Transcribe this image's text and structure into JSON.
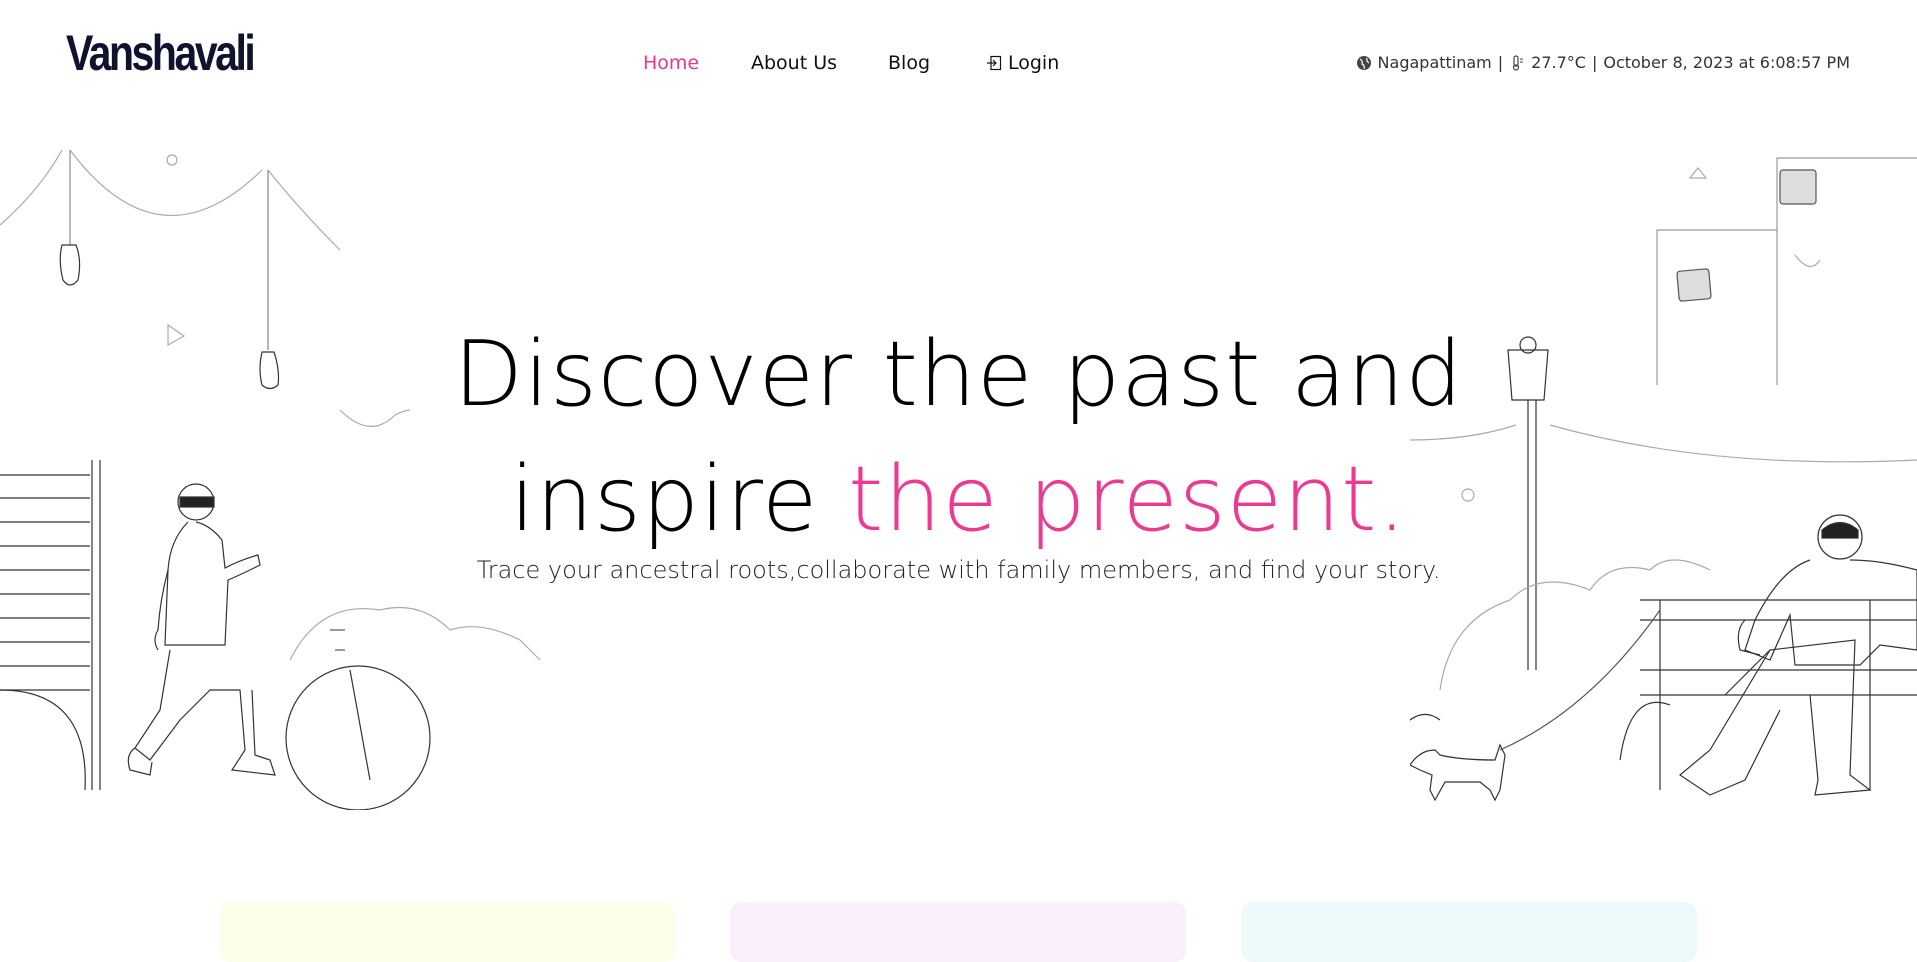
{
  "brand": {
    "name": "Vanshavali"
  },
  "nav": {
    "items": [
      {
        "label": "Home",
        "active": true
      },
      {
        "label": "About Us",
        "active": false
      },
      {
        "label": "Blog",
        "active": false
      },
      {
        "label": "Login",
        "active": false
      }
    ]
  },
  "status": {
    "location": "Nagapattinam",
    "temperature": "27.7°C",
    "datetime": "October 8, 2023 at 6:08:57 PM",
    "separator": "|"
  },
  "hero": {
    "line1": "Discover the past and",
    "line2_prefix": "inspire ",
    "line2_highlight": "the present.",
    "subtitle": "Trace your ancestral roots,collaborate with family members, and find your story."
  },
  "colors": {
    "accent": "#ec3a93",
    "brand": "#0f1330",
    "card1": "#fdfee7",
    "card2": "#faf0fc",
    "card3": "#edf9fa"
  },
  "icons": {
    "location": "globe-icon",
    "temperature": "thermometer-icon",
    "login": "login-icon"
  }
}
